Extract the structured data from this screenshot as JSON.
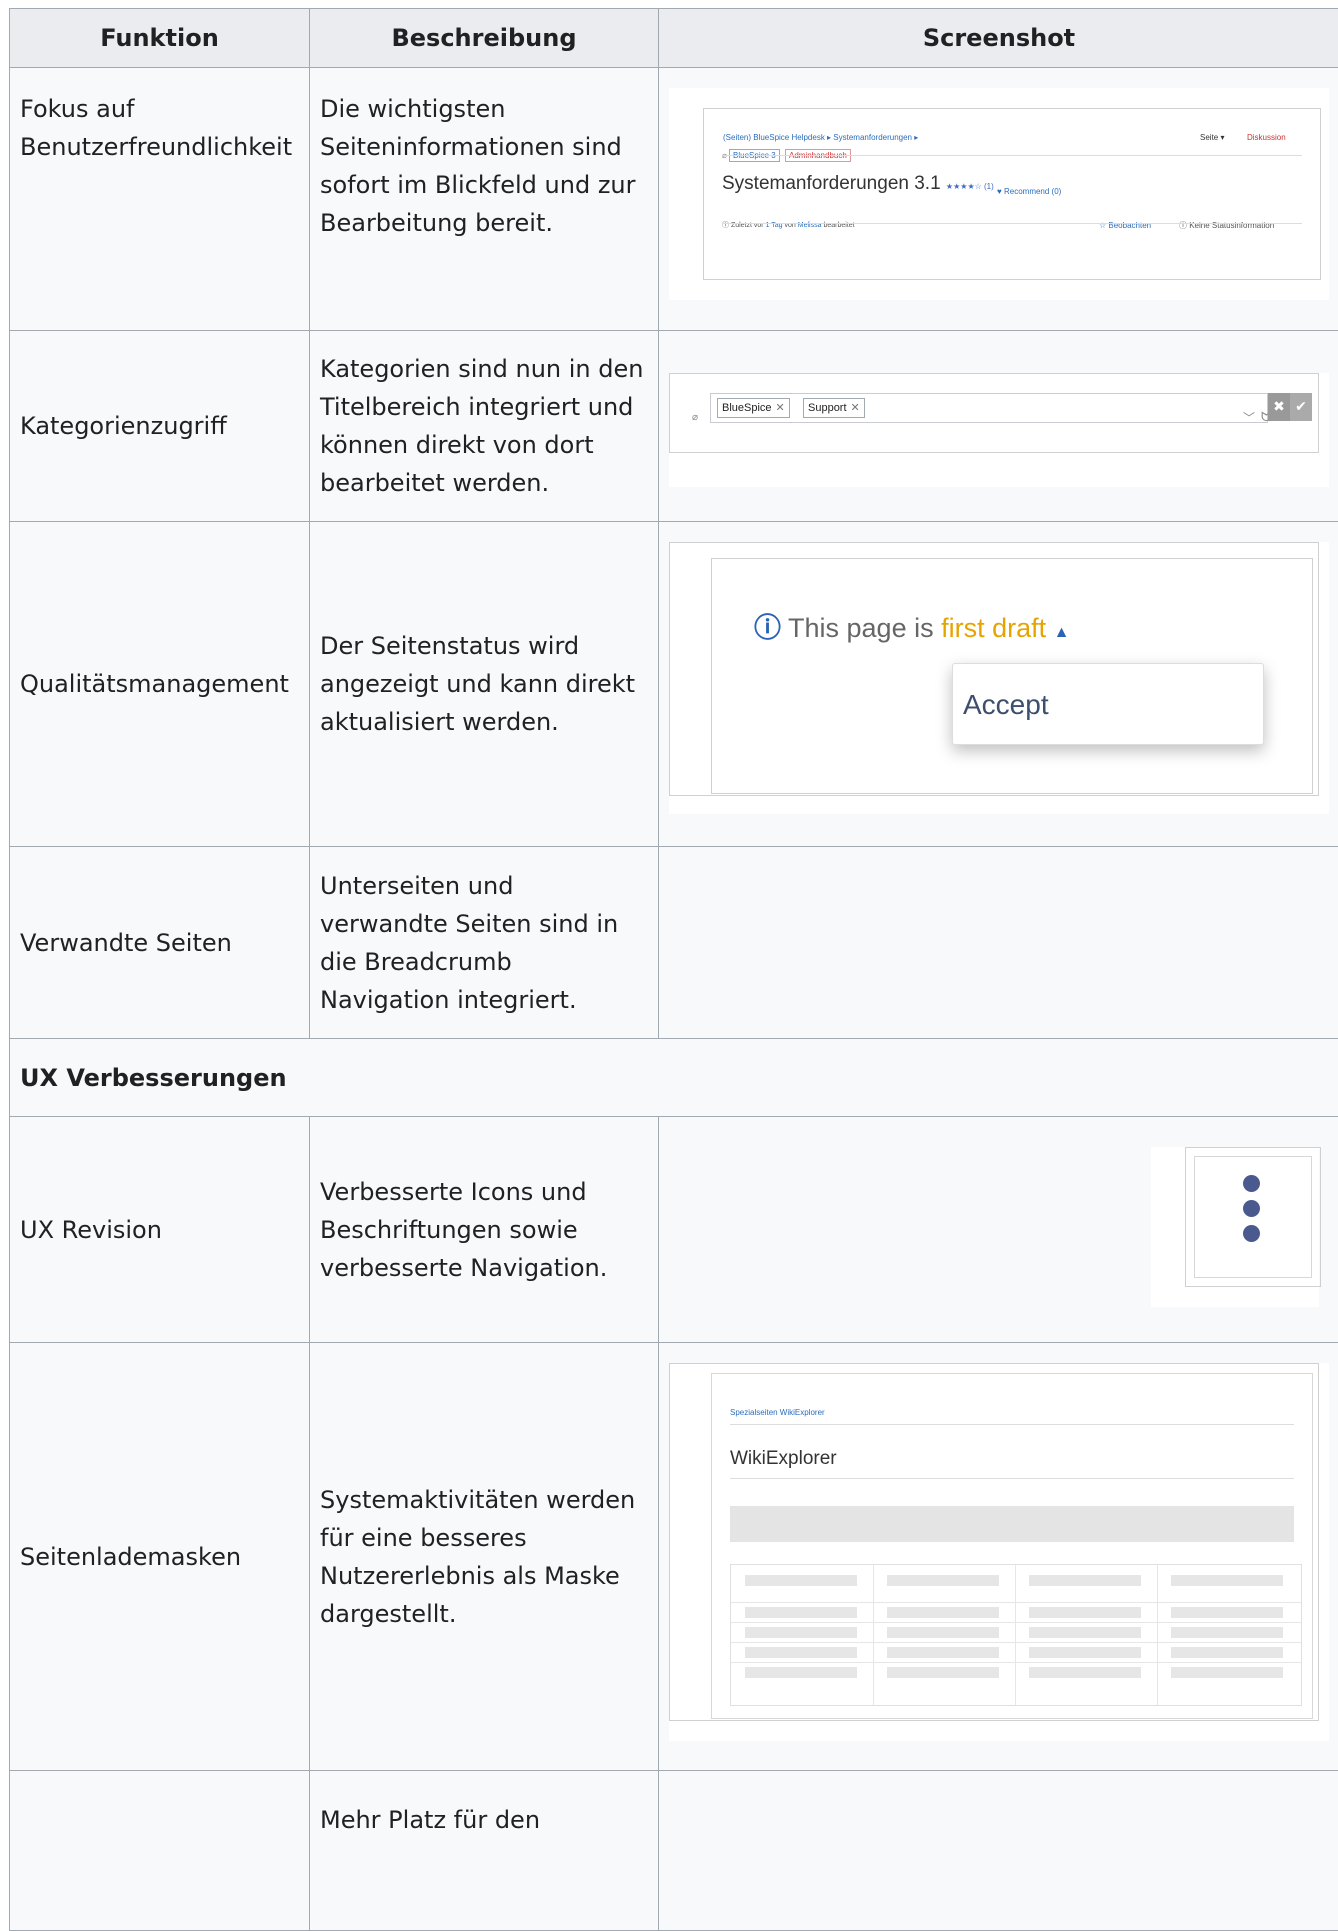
{
  "table": {
    "headers": [
      "Funktion",
      "Beschreibung",
      "Screenshot"
    ],
    "rows": [
      {
        "funktion": "Fokus auf Benutzerfreundlichkeit",
        "beschreibung": "Die wichtigsten Seiteninformationen sind sofort im Blickfeld und zur Bearbeitung bereit."
      },
      {
        "funktion": "Kategorienzugriff",
        "beschreibung": "Kategorien sind nun in den Titelbereich integriert und können direkt von dort bearbeitet werden."
      },
      {
        "funktion": "Qualitätsmanagement",
        "beschreibung": "Der Seitenstatus wird angezeigt und kann direkt aktualisiert werden."
      },
      {
        "funktion": "Verwandte Seiten",
        "beschreibung": "Unterseiten und verwandte Seiten sind in die Breadcrumb Navigation integriert."
      },
      {
        "funktion": "UX Revision",
        "beschreibung": "Verbesserte Icons und Beschriftungen sowie verbesserte Navigation."
      },
      {
        "funktion": "Seitenlademasken",
        "beschreibung": "Systemaktivitäten werden für eine besseres Nutzererlebnis als Maske dargestellt."
      },
      {
        "funktion": "",
        "beschreibung": "Mehr Platz für den"
      }
    ],
    "section_title": "UX Verbesserungen"
  },
  "shot1": {
    "breadcrumb": "(Seiten)   BlueSpice Helpdesk   ▸   Systemanforderungen   ▸",
    "seite": "Seite ▾",
    "diskussion": "Diskussion",
    "tags": [
      "BlueSpice 3",
      "Adminhandbuch"
    ],
    "title": "Systemanforderungen 3.1",
    "stars": "★★★★☆ (1)",
    "recommend": "♥ Recommend (0)",
    "last_edit_prefix": "ⓘ Zuletzt vor ",
    "last_edit_link1": "1 Tag",
    "last_edit_mid": " von ",
    "last_edit_link2": "Melissa",
    "last_edit_suffix": " bearbeitet",
    "beobachten": "☆ Beobachten",
    "keine_status": "ⓘ Keine Statusinformation"
  },
  "shot2": {
    "chips": [
      "BlueSpice",
      "Support"
    ]
  },
  "shot3": {
    "status_prefix": "This page is ",
    "status_value": "first draft",
    "menu_item": "Accept"
  },
  "shot5": {
    "breadcrumb": "Spezialseiten   WikiExplorer",
    "title": "WikiExplorer"
  }
}
